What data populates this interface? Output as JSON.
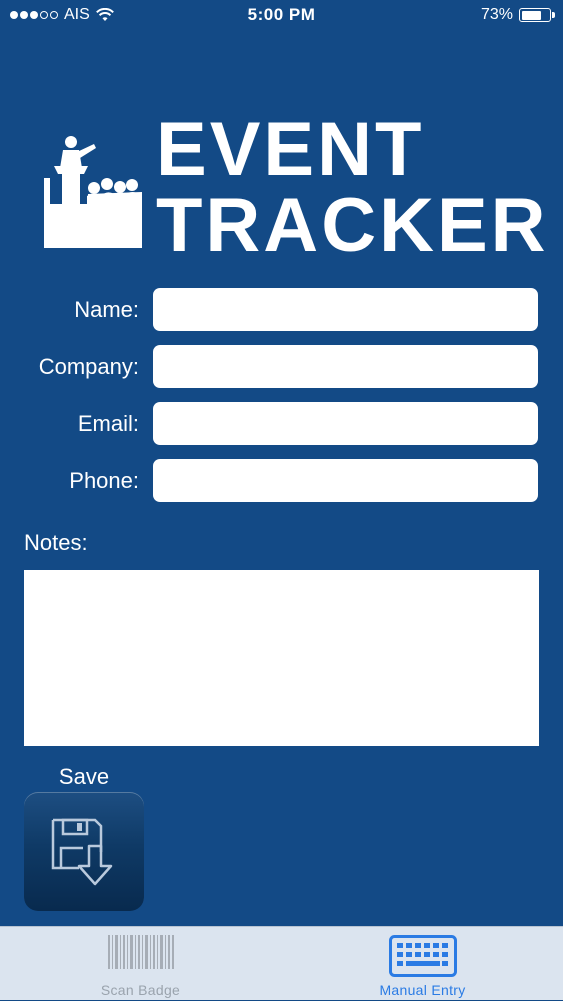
{
  "status_bar": {
    "carrier": "AIS",
    "time": "5:00 PM",
    "battery_percent_label": "73%",
    "battery_level": 0.73
  },
  "logo": {
    "line1": "EVENT",
    "line2": "TRACKER"
  },
  "form": {
    "name_label": "Name:",
    "name_value": "",
    "company_label": "Company:",
    "company_value": "",
    "email_label": "Email:",
    "email_value": "",
    "phone_label": "Phone:",
    "phone_value": "",
    "notes_label": "Notes:",
    "notes_value": "",
    "save_label": "Save"
  },
  "tab_bar": {
    "tabs": [
      {
        "label": "Scan Badge",
        "icon": "barcode-icon",
        "active": false
      },
      {
        "label": "Manual Entry",
        "icon": "keyboard-icon",
        "active": true
      }
    ]
  },
  "colors": {
    "background": "#134a86",
    "tab_bar": "#dbe4ef",
    "active_tab": "#2a7be4",
    "inactive_tab": "#9aa3ad"
  }
}
